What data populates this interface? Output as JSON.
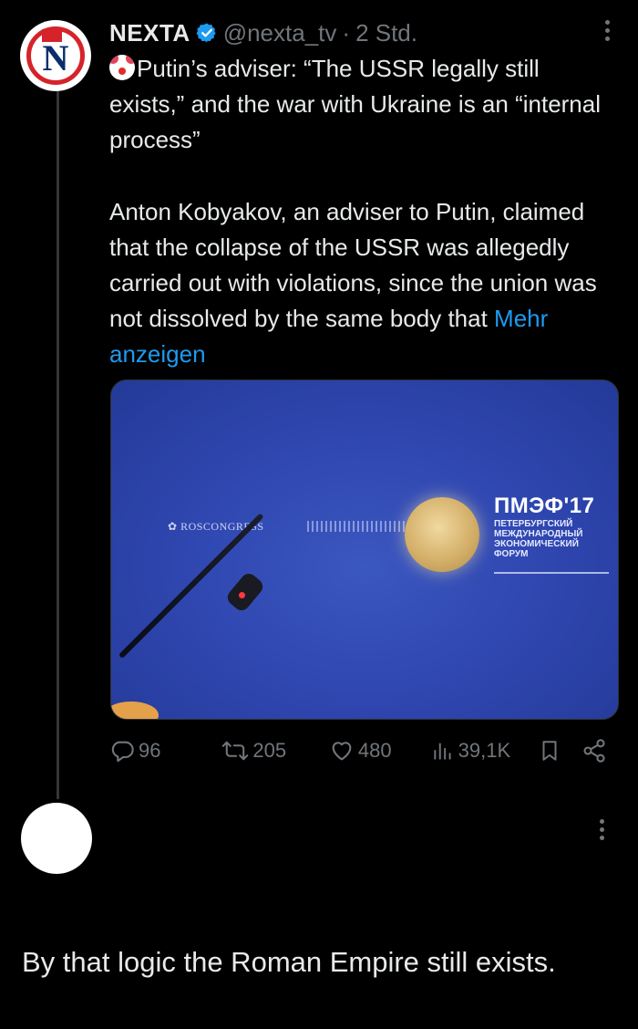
{
  "tweet": {
    "author_name": "NEXTA",
    "handle": "@nexta_tv",
    "separator": "·",
    "time": "2 Std.",
    "text_line1": "Putin’s adviser: “The USSR legally still exists,” and the war with Ukraine is an “internal process”",
    "text_para2": "Anton Kobyakov, an adviser to Putin, claimed that the collapse of the USSR was allegedly carried out with violations, since the union was not dissolved by the same body that",
    "more_link": "Mehr anzeigen",
    "media": {
      "banner_left": "ROSCONGRESS",
      "forum_title": "ПМЭФ'17",
      "forum_sub": [
        "ПЕТЕРБУРГСКИЙ",
        "МЕЖДУНАРОДНЫЙ",
        "ЭКОНОМИЧЕСКИЙ",
        "ФОРУМ"
      ]
    },
    "stats": {
      "replies": "96",
      "retweets": "205",
      "likes": "480",
      "views": "39,1K"
    }
  },
  "comment": {
    "text": "By that logic the Roman Empire still exists."
  },
  "colors": {
    "background": "#000000",
    "text": "#e7e9ea",
    "muted": "#71767b",
    "link": "#1d9bf0",
    "verified": "#1d9bf0"
  }
}
